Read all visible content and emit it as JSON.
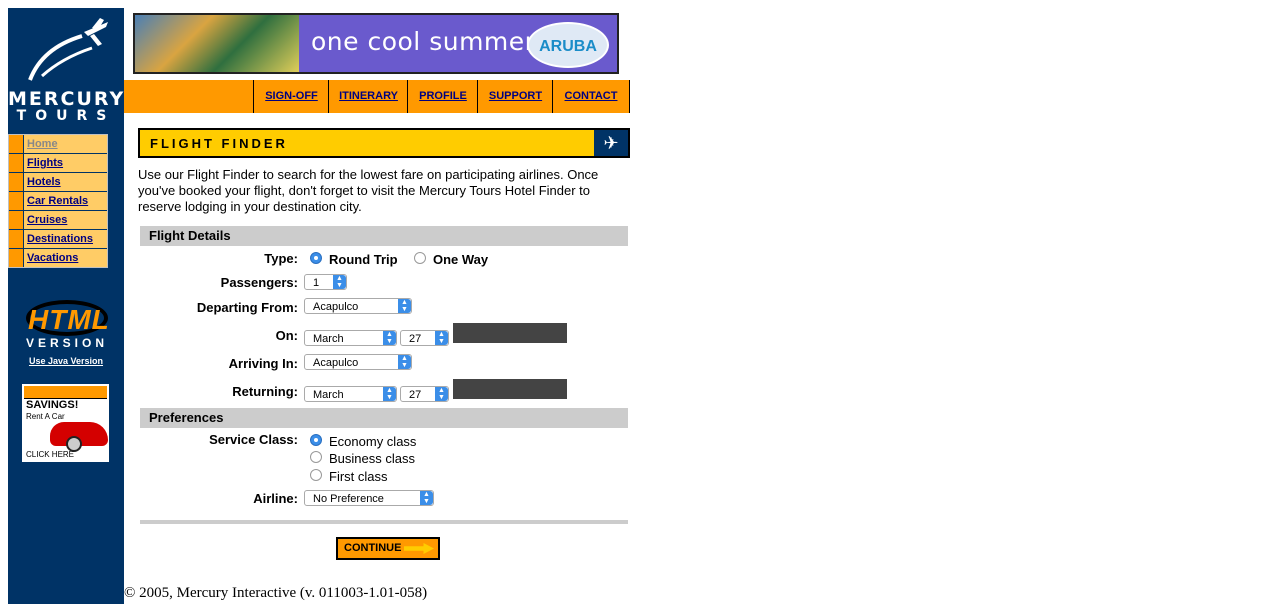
{
  "brand": {
    "line1": "MERCURY",
    "line2": "TOURS"
  },
  "sidebar": {
    "items": [
      {
        "label": "Home"
      },
      {
        "label": "Flights"
      },
      {
        "label": "Hotels"
      },
      {
        "label": "Car Rentals"
      },
      {
        "label": "Cruises"
      },
      {
        "label": "Destinations"
      },
      {
        "label": "Vacations"
      }
    ],
    "html_version": "HTML",
    "version_word": "VERSION",
    "java_link": "Use Java Version",
    "ad": {
      "line1": "SAVINGS!",
      "line2": "Rent A Car",
      "cta": "CLICK HERE"
    }
  },
  "banner": {
    "text": "one cool summer",
    "logo": "ARUBA"
  },
  "nav": [
    "SIGN-OFF",
    "ITINERARY",
    "PROFILE",
    "SUPPORT",
    "CONTACT"
  ],
  "finder": {
    "title": "FLIGHT FINDER",
    "intro": "Use our Flight Finder to search for the lowest fare on participating airlines. Once you've booked your flight, don't forget to visit the Mercury Tours Hotel Finder to reserve lodging in your destination city."
  },
  "details": {
    "heading": "Flight Details",
    "type_label": "Type:",
    "round_trip": "Round Trip",
    "one_way": "One Way",
    "passengers_label": "Passengers:",
    "passengers": "1",
    "departing_label": "Departing From:",
    "departing": "Acapulco",
    "on_label": "On:",
    "on_month": "March",
    "on_day": "27",
    "arriving_label": "Arriving In:",
    "arriving": "Acapulco",
    "returning_label": "Returning:",
    "ret_month": "March",
    "ret_day": "27"
  },
  "prefs": {
    "heading": "Preferences",
    "class_label": "Service Class:",
    "economy": "Economy class",
    "business": "Business class",
    "first": "First class",
    "airline_label": "Airline:",
    "airline": "No Preference"
  },
  "continue": "CONTINUE",
  "footer": "© 2005, Mercury Interactive (v. 011003-1.01-058)",
  "colors": {
    "navy": "#003366",
    "orange": "#ff9900",
    "yellow": "#ffcc00",
    "link": "#000080"
  }
}
